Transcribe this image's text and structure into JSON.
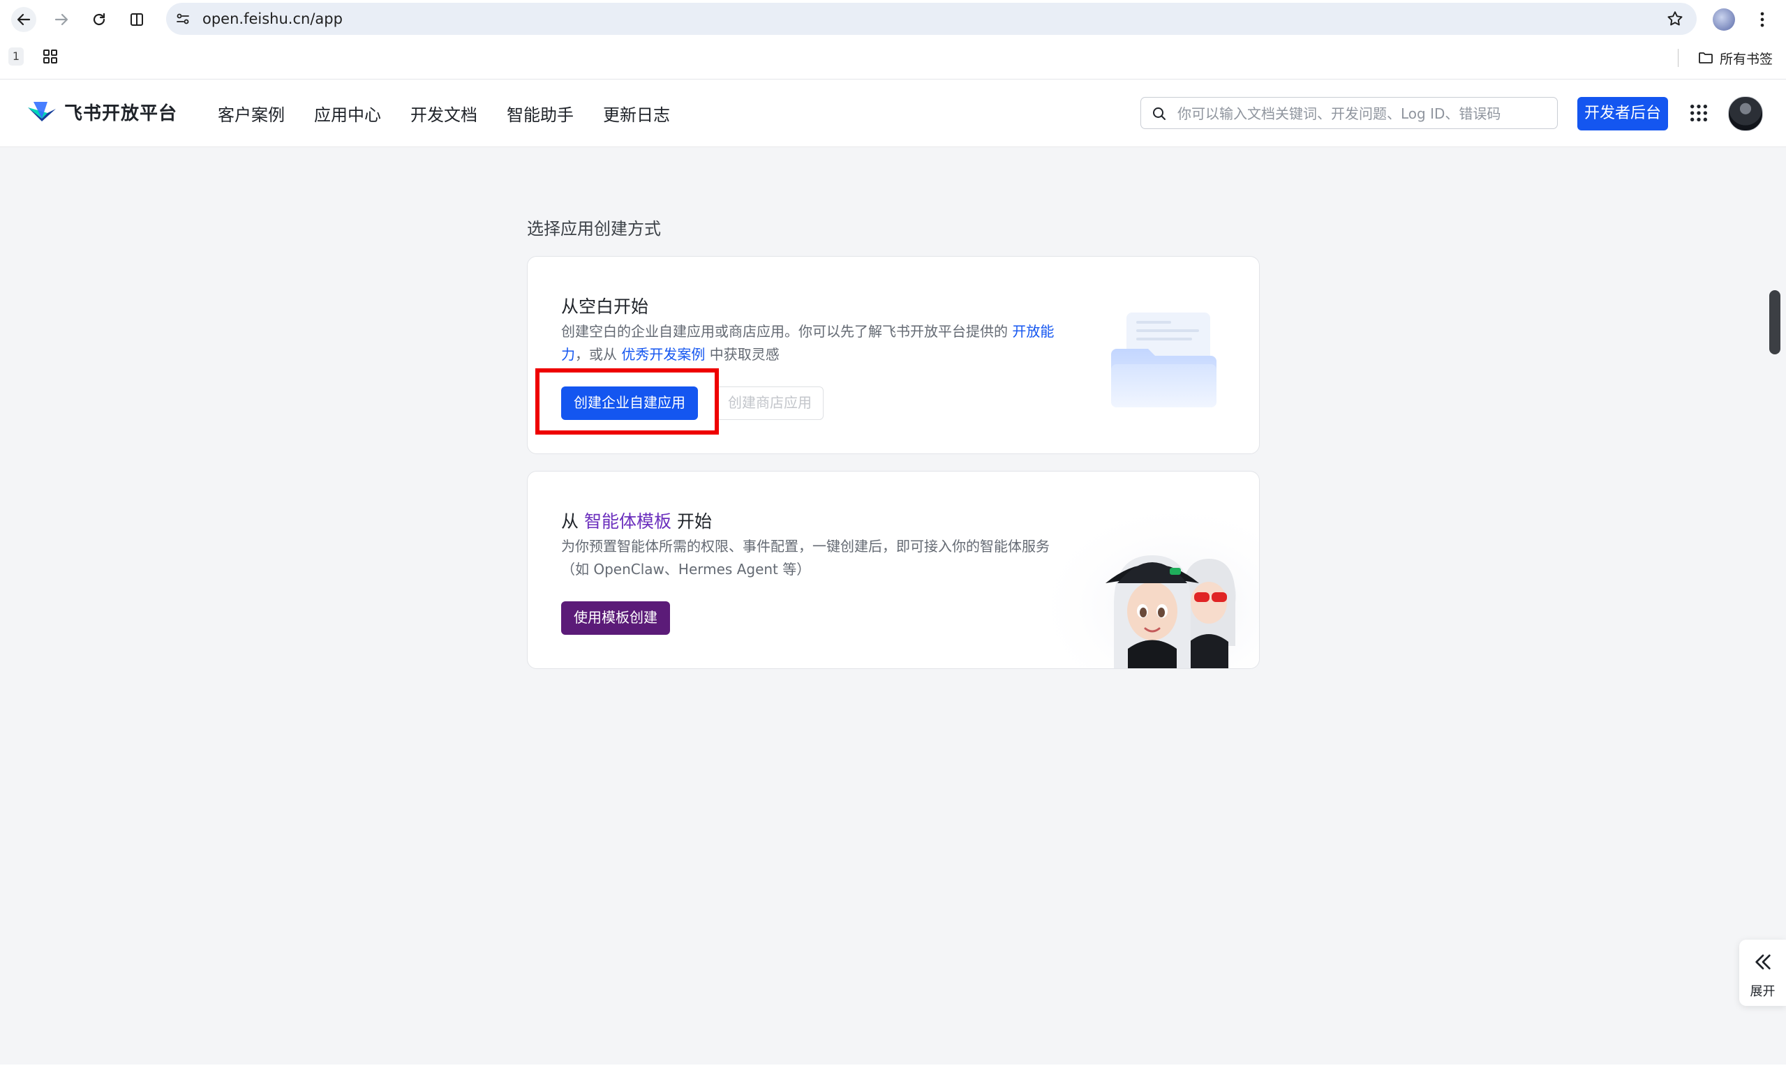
{
  "browser": {
    "url": "open.feishu.cn/app",
    "tab_count": "1",
    "all_bookmarks_label": "所有书签"
  },
  "header": {
    "logo_text": "飞书开放平台",
    "nav": [
      {
        "label": "客户案例"
      },
      {
        "label": "应用中心"
      },
      {
        "label": "开发文档"
      },
      {
        "label": "智能助手"
      },
      {
        "label": "更新日志"
      }
    ],
    "search_placeholder": "你可以输入文档关键词、开发问题、Log ID、错误码",
    "console_button": "开发者后台"
  },
  "main": {
    "section_title": "选择应用创建方式",
    "blank_card": {
      "title": "从空白开始",
      "desc_part1": "创建空白的企业自建应用或商店应用。你可以先了解飞书开放平台提供的",
      "link_capability": "开放能力",
      "desc_part2": "，或从",
      "link_cases": "优秀开发案例",
      "desc_part3": "中获取灵感",
      "primary_button": "创建企业自建应用",
      "secondary_button": "创建商店应用"
    },
    "agent_card": {
      "title_prefix": "从",
      "title_link": "智能体模板",
      "title_suffix": "开始",
      "desc": "为你预置智能体所需的权限、事件配置，一键创建后，即可接入你的智能体服务（如 OpenClaw、Hermes Agent 等）",
      "button": "使用模板创建"
    }
  },
  "side_panel": {
    "expand_label": "展开"
  },
  "colors": {
    "brand_blue": "#1456f0",
    "agent_purple": "#5b1b78",
    "highlight_red": "#ee0000"
  }
}
